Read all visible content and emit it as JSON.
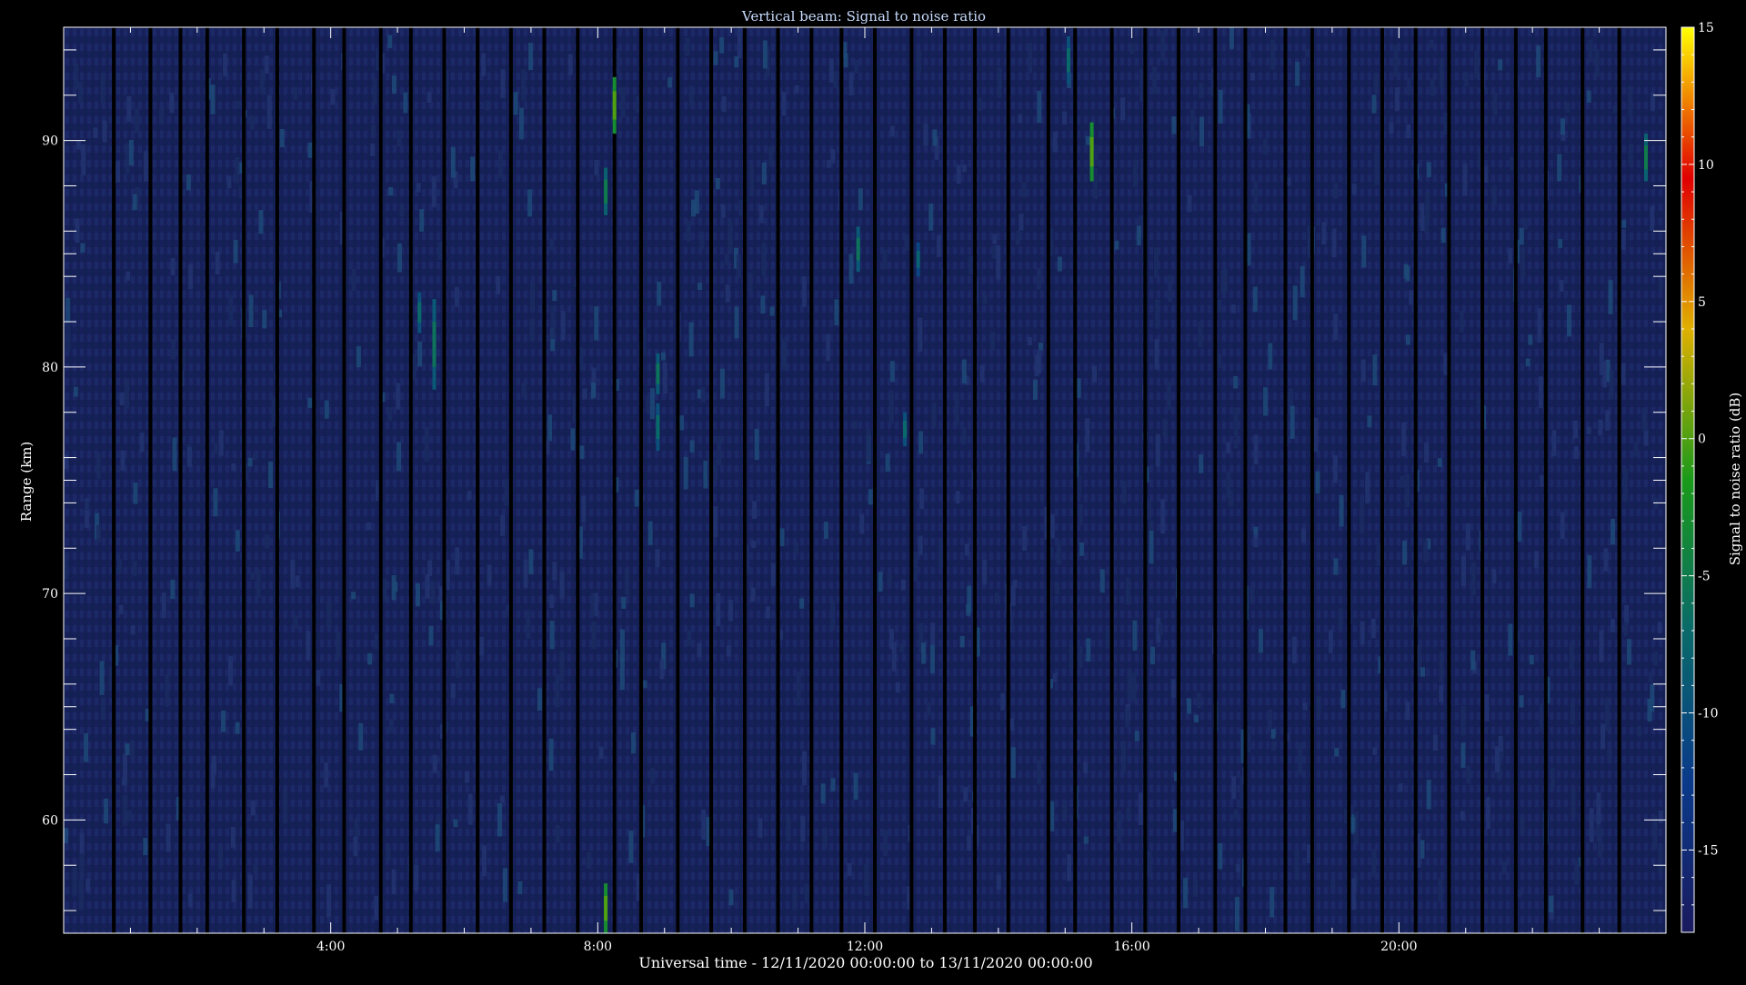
{
  "chart_data": {
    "type": "heatmap",
    "title": "Vertical beam: Signal to noise ratio",
    "xlabel": "Universal time - 12/11/2020 00:00:00 to 13/11/2020 00:00:00",
    "ylabel": "Range (km)",
    "x_unit": "hours UT",
    "xlim": [
      0,
      24
    ],
    "ylim": [
      55,
      95
    ],
    "x_ticks": [
      4,
      8,
      12,
      16,
      20
    ],
    "x_tick_labels": [
      "4:00",
      "8:00",
      "12:00",
      "16:00",
      "20:00"
    ],
    "y_ticks": [
      60,
      70,
      80,
      90
    ],
    "y_tick_labels": [
      "60",
      "70",
      "80",
      "90"
    ],
    "colorbar": {
      "label": "Signal to noise ratio (dB)",
      "range": [
        -18,
        15
      ],
      "ticks": [
        15,
        10,
        5,
        0,
        -5,
        -10,
        -15
      ],
      "tick_labels": [
        "15",
        "10",
        "5",
        "0",
        "-5",
        "-10",
        "-15"
      ],
      "colormap": [
        "#1a1a5e",
        "#0a3a8a",
        "#0a6a6a",
        "#1a9a1a",
        "#e0b000",
        "#e00000",
        "#ffff00"
      ]
    },
    "background_snr_db": -16,
    "data_gaps_hours": [
      0.75,
      1.3,
      1.75,
      2.15,
      2.7,
      3.2,
      3.75,
      4.2,
      4.75,
      5.2,
      5.7,
      6.2,
      6.7,
      7.2,
      7.7,
      8.25,
      8.65,
      9.2,
      9.7,
      10.2,
      10.7,
      11.2,
      11.65,
      12.15,
      12.7,
      13.2,
      13.65,
      14.15,
      14.75,
      15.15,
      15.7,
      16.2,
      16.7,
      17.25,
      17.7,
      18.3,
      18.7,
      19.25,
      19.75,
      20.25,
      20.75,
      21.25,
      21.75,
      22.2,
      22.75,
      23.3
    ],
    "echoes": [
      {
        "time": 8.25,
        "range_from": 90.3,
        "range_to": 92.8,
        "snr_db": 0
      },
      {
        "time": 8.12,
        "range_from": 86.7,
        "range_to": 88.8,
        "snr_db": -5
      },
      {
        "time": 5.55,
        "range_from": 79.0,
        "range_to": 83.0,
        "snr_db": -6
      },
      {
        "time": 5.33,
        "range_from": 81.5,
        "range_to": 83.3,
        "snr_db": -7
      },
      {
        "time": 8.9,
        "range_from": 78.8,
        "range_to": 80.6,
        "snr_db": -6
      },
      {
        "time": 8.9,
        "range_from": 76.3,
        "range_to": 78.4,
        "snr_db": -7
      },
      {
        "time": 11.9,
        "range_from": 84.2,
        "range_to": 86.2,
        "snr_db": -6
      },
      {
        "time": 12.6,
        "range_from": 76.5,
        "range_to": 78.0,
        "snr_db": -7
      },
      {
        "time": 12.8,
        "range_from": 84.0,
        "range_to": 85.5,
        "snr_db": -8
      },
      {
        "time": 15.05,
        "range_from": 92.5,
        "range_to": 94.6,
        "snr_db": -7
      },
      {
        "time": 15.4,
        "range_from": 88.2,
        "range_to": 90.8,
        "snr_db": 0
      },
      {
        "time": 23.7,
        "range_from": 88.2,
        "range_to": 90.3,
        "snr_db": -5
      },
      {
        "time": 8.12,
        "range_from": 55.0,
        "range_to": 57.2,
        "snr_db": 0
      }
    ]
  }
}
